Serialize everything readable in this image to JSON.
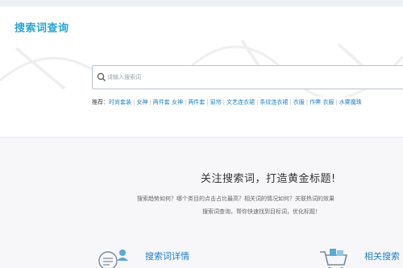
{
  "header": {
    "title": "搜索词查询"
  },
  "search": {
    "placeholder": "请输入搜索词"
  },
  "tags": {
    "label": "推荐：",
    "items": [
      "时尚套装",
      "女神",
      "两件套 女神",
      "两件套",
      "窗帘",
      "文艺连衣裙",
      "条纹连衣裙",
      "衣服",
      "作弊 衣服",
      "水雾魔珠"
    ]
  },
  "main": {
    "headline": "关注搜索词，打造黄金标题!",
    "desc_line1": "搜索趋势如何？哪个类目的点击占比最高？相关词的情况如何？关联热词的效果",
    "desc_line2": "搜索词查询，帮你快速找到目标词，优化标题！"
  },
  "features": {
    "left_title": "搜索词详情",
    "right_title": "相关搜索"
  },
  "colors": {
    "accent": "#2aa7cf",
    "link": "#1f7fc5",
    "main_bg": "#f7f7f9"
  }
}
